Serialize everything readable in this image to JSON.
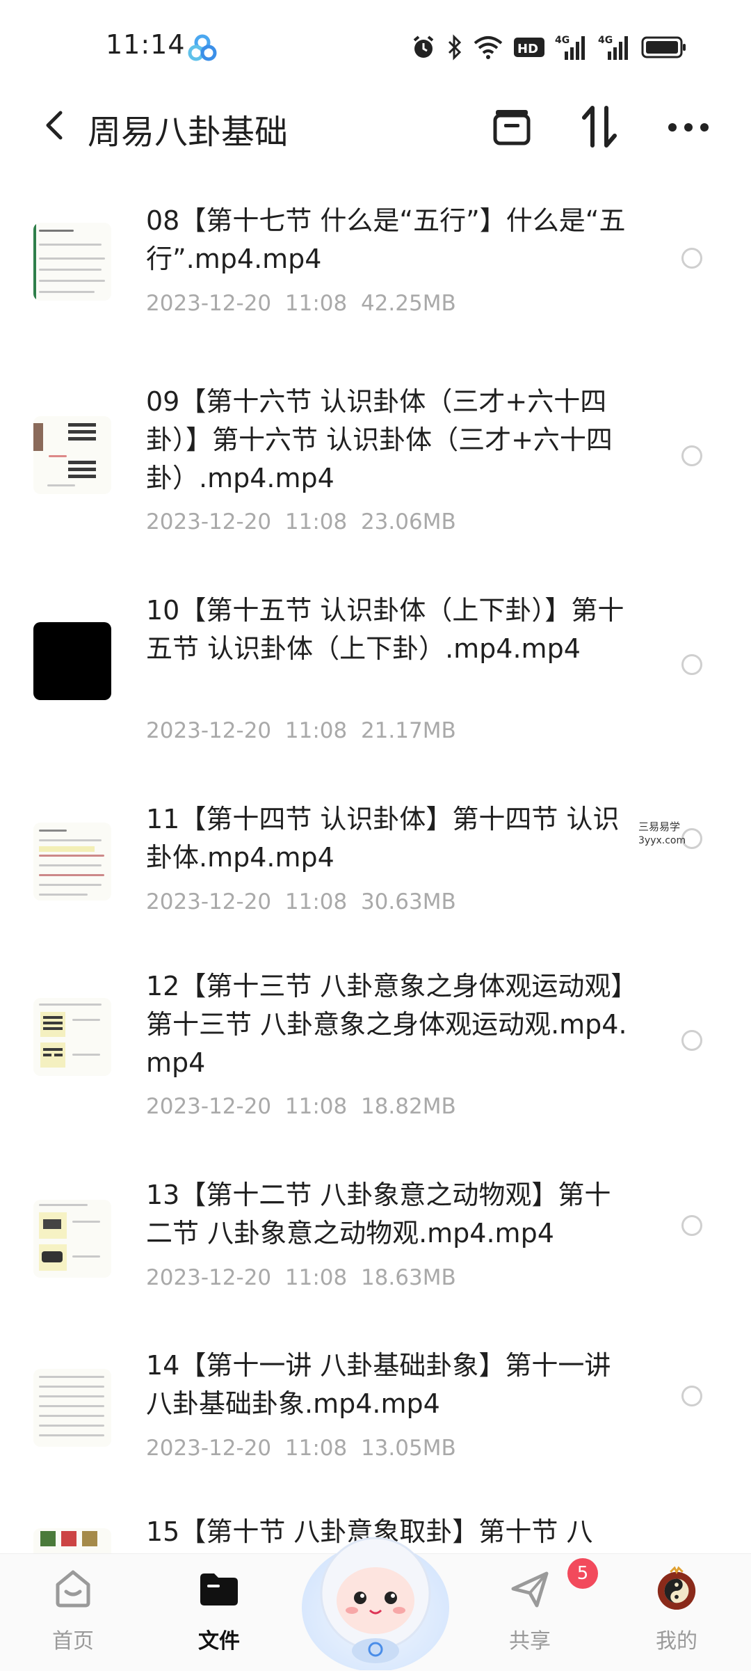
{
  "status_bar": {
    "time": "11:14",
    "icons": [
      "cloud-app-icon",
      "alarm-icon",
      "bluetooth-icon",
      "wifi-icon",
      "hd-icon",
      "signal-4g-icon",
      "signal-4g-icon",
      "battery-icon"
    ],
    "hd_label": "HD",
    "net1": "4G",
    "net2": "4G"
  },
  "header": {
    "title": "周易八卦基础",
    "back_icon": "chevron-left-icon",
    "actions": [
      "select-box-icon",
      "sort-icon",
      "more-icon"
    ]
  },
  "files": [
    {
      "name": "08【第十七节 什么是“五行”】什么是“五行”.mp4.mp4",
      "date": "2023-12-20",
      "time": "11:08",
      "size": "42.25MB"
    },
    {
      "name": "09【第十六节 认识卦体（三才+六十四卦）】第十六节 认识卦体（三才+六十四卦）.mp4.mp4",
      "date": "2023-12-20",
      "time": "11:08",
      "size": "23.06MB"
    },
    {
      "name": "10【第十五节 认识卦体（上下卦）】第十五节 认识卦体（上下卦）.mp4.mp4",
      "date": "2023-12-20",
      "time": "11:08",
      "size": "21.17MB"
    },
    {
      "name": "11【第十四节 认识卦体】第十四节 认识卦体.mp4.mp4",
      "date": "2023-12-20",
      "time": "11:08",
      "size": "30.63MB"
    },
    {
      "name": "12【第十三节 八卦意象之身体观运动观】第十三节 八卦意象之身体观运动观.mp4.mp4",
      "date": "2023-12-20",
      "time": "11:08",
      "size": "18.82MB"
    },
    {
      "name": "13【第十二节 八卦象意之动物观】第十二节 八卦象意之动物观.mp4.mp4",
      "date": "2023-12-20",
      "time": "11:08",
      "size": "18.63MB"
    },
    {
      "name": "14【第十一讲 八卦基础卦象】第十一讲 八卦基础卦象.mp4.mp4",
      "date": "2023-12-20",
      "time": "11:08",
      "size": "13.05MB"
    },
    {
      "name": "15【第十节 八卦意象取卦】第十节 八",
      "date": "",
      "time": "",
      "size": ""
    }
  ],
  "watermark": {
    "line1": "三易易学",
    "line2": "3yyx.com"
  },
  "bottom_nav": {
    "home": "首页",
    "files": "文件",
    "share": "共享",
    "mine": "我的",
    "share_badge": "5"
  },
  "colors": {
    "accent": "#1f1f1f",
    "meta": "#a9a9a9",
    "badge": "#f24a5c"
  }
}
